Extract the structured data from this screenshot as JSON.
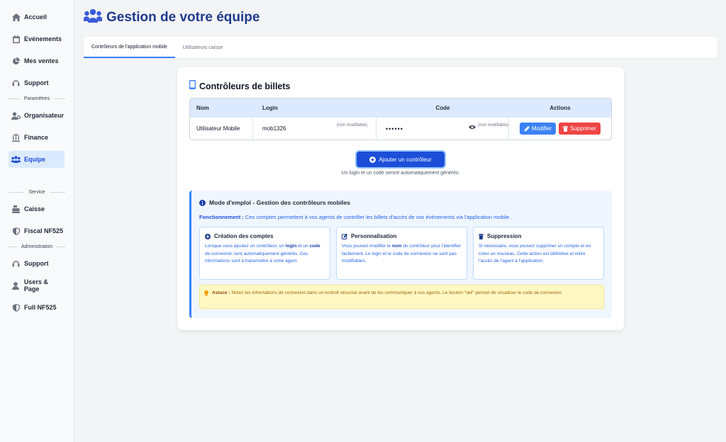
{
  "sidebar": {
    "items_top": [
      {
        "label": "Accueil",
        "icon": "home-icon"
      },
      {
        "label": "Evénements",
        "icon": "calendar-icon"
      },
      {
        "label": "Mes ventes",
        "icon": "pie-chart-icon"
      },
      {
        "label": "Support",
        "icon": "headset-icon"
      }
    ],
    "section_params": "Paramètres",
    "items_params": [
      {
        "label": "Organisateur",
        "icon": "user-gear-icon"
      },
      {
        "label": "Finance",
        "icon": "bank-icon"
      },
      {
        "label": "Equipe",
        "icon": "team-icon",
        "active": true
      }
    ],
    "section_service": "Service",
    "items_service": [
      {
        "label": "Caisse",
        "icon": "cash-register-icon"
      },
      {
        "label": "Fiscal NF525",
        "icon": "shield-icon"
      }
    ],
    "section_admin": "Administration",
    "items_admin": [
      {
        "label": "Support",
        "icon": "headset-icon"
      },
      {
        "label": "Users & Page",
        "icon": "user-icon"
      },
      {
        "label": "Full NF525",
        "icon": "shield-icon"
      }
    ]
  },
  "header": {
    "title": "Gestion de votre équipe"
  },
  "tabs": [
    {
      "label": "Contrôleurs de l'application mobile",
      "active": true
    },
    {
      "label": "Utilisateurs caisse",
      "active": false
    }
  ],
  "card": {
    "title": "Contrôleurs de billets",
    "table": {
      "headers": {
        "nom": "Nom",
        "login": "Login",
        "code": "Code",
        "actions": "Actions"
      },
      "rows": [
        {
          "nom": "Utilisateur Mobile",
          "login": "mob1326",
          "login_note": "(non modifiable)",
          "code": "••••••",
          "code_note": "(non modifiable)"
        }
      ],
      "edit_label": "Modifier",
      "delete_label": "Supprimer"
    },
    "add_button": "Ajouter un contrôleur",
    "add_hint": "Un login et un code seront automatiquement générés."
  },
  "info": {
    "title": "Mode d'emploi - Gestion des contrôleurs mobiles",
    "desc_label": "Fonctionnement :",
    "desc_text": " Ces comptes permettent à vos agents de contrôler les billets d'accès de vos événements via l'application mobile.",
    "blocks": [
      {
        "title": "Création des comptes",
        "p1": "Lorsque vous ajoutez un contrôleur, un ",
        "b1": "login",
        "p2": " et un ",
        "b2": "code",
        "p3": " de connexion sont automatiquement générés. Ces informations sont à transmettre à votre agent."
      },
      {
        "title": "Personnalisation",
        "p1": "Vous pouvez modifier le ",
        "b1": "nom",
        "p2": " du contrôleur pour l'identifier facilement. Le login et le code de connexion ne sont pas modifiables."
      },
      {
        "title": "Suppression",
        "p1": "Si nécessaire, vous pouvez supprimer un compte et en créer un nouveau. Cette action est définitive et retire l'accès de l'agent à l'application."
      }
    ],
    "tip_label": "Astuce :",
    "tip_text": " Notez les informations de connexion dans un endroit sécurisé avant de les communiquer à vos agents. Le bouton \"œil\" permet de visualiser le code de connexion."
  },
  "colors": {
    "accent": "#3b82f6",
    "danger": "#ef4444",
    "title": "#1e3a8a"
  }
}
